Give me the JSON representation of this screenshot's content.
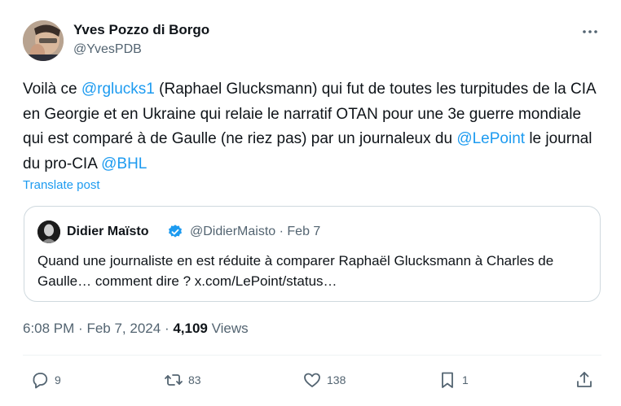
{
  "author": {
    "name": "Yves Pozzo di Borgo",
    "handle": "@YvesPDB"
  },
  "post": {
    "segments": [
      {
        "text": "Voilà ce ",
        "mention": false
      },
      {
        "text": "@rglucks1",
        "mention": true
      },
      {
        "text": " (Raphael Glucksmann) qui fut de toutes les turpitudes de la CIA en Georgie et en Ukraine qui relaie le narratif OTAN pour une 3e guerre mondiale qui est comparé à de Gaulle (ne riez pas) par un journaleux du ",
        "mention": false
      },
      {
        "text": "@LePoint",
        "mention": true
      },
      {
        "text": " le journal du pro-CIA ",
        "mention": false
      },
      {
        "text": "@BHL",
        "mention": true
      }
    ],
    "translate_label": "Translate post"
  },
  "quote": {
    "name": "Didier Maïsto",
    "handle": "@DidierMaisto",
    "separator": "·",
    "date": "Feb 7",
    "text": "Quand une journaliste en est réduite à comparer Raphaël Glucksmann à Charles de Gaulle… comment dire ? x.com/LePoint/status…"
  },
  "meta": {
    "time": "6:08 PM",
    "separator": "·",
    "date": "Feb 7, 2024",
    "views_count": "4,109",
    "views_label": "Views"
  },
  "actions": {
    "replies": "9",
    "reposts": "83",
    "likes": "138",
    "bookmarks": "1"
  },
  "colors": {
    "accent": "#1d9bf0",
    "text": "#0f1419",
    "secondary": "#536471",
    "border": "#cfd9de"
  },
  "icons": [
    "more-icon",
    "verified-icon",
    "reply-icon",
    "repost-icon",
    "like-icon",
    "bookmark-icon",
    "share-icon"
  ]
}
